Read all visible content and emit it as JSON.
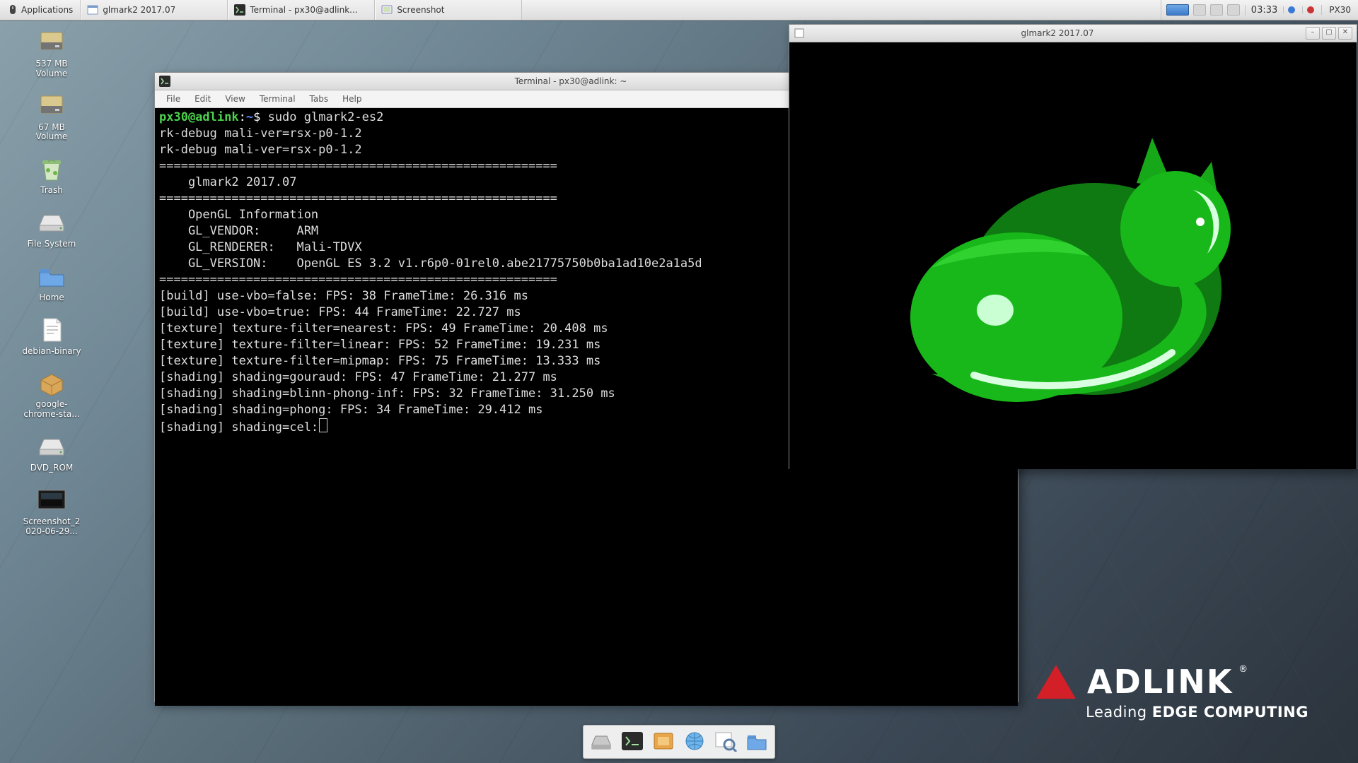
{
  "panel": {
    "applications": "Applications",
    "tasks": [
      {
        "icon": "window",
        "label": "glmark2 2017.07"
      },
      {
        "icon": "terminal",
        "label": "Terminal - px30@adlink..."
      },
      {
        "icon": "screenshot",
        "label": "Screenshot"
      }
    ],
    "clock": "03:33",
    "host": "PX30"
  },
  "desktop_icons": [
    {
      "key": "vol1",
      "kind": "disk",
      "label": "537 MB\nVolume"
    },
    {
      "key": "vol2",
      "kind": "disk",
      "label": "67 MB\nVolume"
    },
    {
      "key": "trash",
      "kind": "trash",
      "label": "Trash"
    },
    {
      "key": "fs",
      "kind": "drive",
      "label": "File System"
    },
    {
      "key": "home",
      "kind": "folder",
      "label": "Home"
    },
    {
      "key": "deb",
      "kind": "file",
      "label": "debian-binary"
    },
    {
      "key": "chrome",
      "kind": "package",
      "label": "google-\nchrome-sta..."
    },
    {
      "key": "dvd",
      "kind": "drive",
      "label": "DVD_ROM"
    },
    {
      "key": "shot",
      "kind": "image",
      "label": "Screenshot_2\n020-06-29..."
    }
  ],
  "dock": [
    "files",
    "terminal",
    "software",
    "web",
    "viewer",
    "folder"
  ],
  "terminal": {
    "title": "Terminal - px30@adlink: ~",
    "menus": [
      "File",
      "Edit",
      "View",
      "Terminal",
      "Tabs",
      "Help"
    ],
    "prompt_user": "px30@adlink",
    "prompt_sep": ":",
    "prompt_path": "~",
    "prompt_sym": "$",
    "lines": [
      {
        "t": "cmd",
        "text": "sudo glmark2-es2"
      },
      {
        "t": "out",
        "text": "rk-debug mali-ver=rsx-p0-1.2"
      },
      {
        "t": "out",
        "text": "rk-debug mali-ver=rsx-p0-1.2"
      },
      {
        "t": "out",
        "text": "======================================================="
      },
      {
        "t": "out",
        "text": "    glmark2 2017.07"
      },
      {
        "t": "out",
        "text": "======================================================="
      },
      {
        "t": "out",
        "text": "    OpenGL Information"
      },
      {
        "t": "out",
        "text": "    GL_VENDOR:     ARM"
      },
      {
        "t": "out",
        "text": "    GL_RENDERER:   Mali-TDVX"
      },
      {
        "t": "out",
        "text": "    GL_VERSION:    OpenGL ES 3.2 v1.r6p0-01rel0.abe21775750b0ba1ad10e2a1a5d"
      },
      {
        "t": "out",
        "text": "======================================================="
      },
      {
        "t": "out",
        "text": "[build] use-vbo=false: FPS: 38 FrameTime: 26.316 ms"
      },
      {
        "t": "out",
        "text": "[build] use-vbo=true: FPS: 44 FrameTime: 22.727 ms"
      },
      {
        "t": "out",
        "text": "[texture] texture-filter=nearest: FPS: 49 FrameTime: 20.408 ms"
      },
      {
        "t": "out",
        "text": "[texture] texture-filter=linear: FPS: 52 FrameTime: 19.231 ms"
      },
      {
        "t": "out",
        "text": "[texture] texture-filter=mipmap: FPS: 75 FrameTime: 13.333 ms"
      },
      {
        "t": "out",
        "text": "[shading] shading=gouraud: FPS: 47 FrameTime: 21.277 ms"
      },
      {
        "t": "out",
        "text": "[shading] shading=blinn-phong-inf: FPS: 32 FrameTime: 31.250 ms"
      },
      {
        "t": "out",
        "text": "[shading] shading=phong: FPS: 34 FrameTime: 29.412 ms"
      },
      {
        "t": "run",
        "text": "[shading] shading=cel:"
      }
    ]
  },
  "glmark": {
    "title": "glmark2 2017.07"
  },
  "brand": {
    "name": "ADLINK",
    "tag_pre": "Leading ",
    "tag_bold": "EDGE COMPUTING",
    "reg": "®"
  }
}
